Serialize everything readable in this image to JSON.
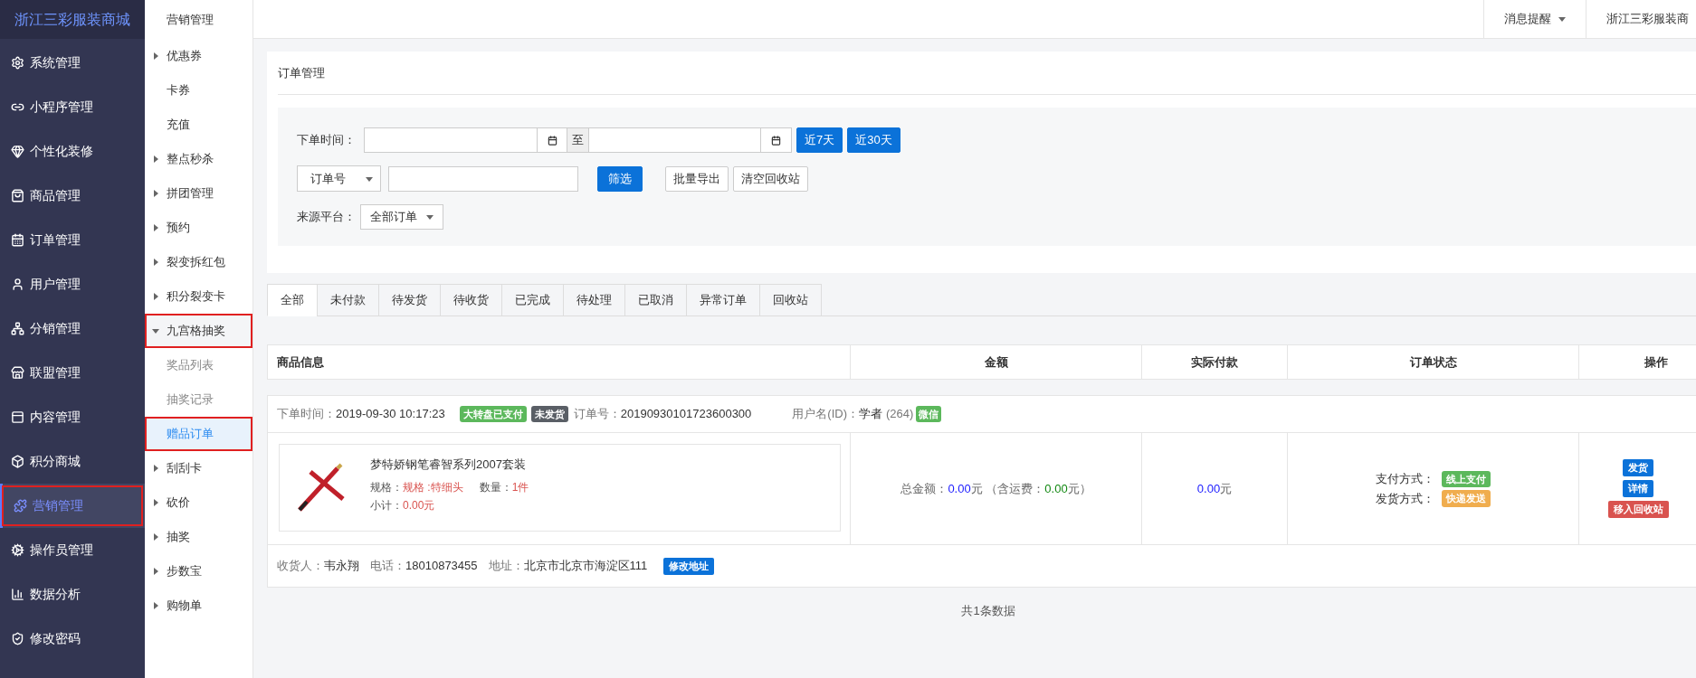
{
  "sidebar": {
    "brand": "浙江三彩服装商城",
    "items": [
      {
        "label": "系统管理",
        "selected": false,
        "annotated": false
      },
      {
        "label": "小程序管理",
        "selected": false,
        "annotated": false
      },
      {
        "label": "个性化装修",
        "selected": false,
        "annotated": false
      },
      {
        "label": "商品管理",
        "selected": false,
        "annotated": false
      },
      {
        "label": "订单管理",
        "selected": false,
        "annotated": false
      },
      {
        "label": "用户管理",
        "selected": false,
        "annotated": false
      },
      {
        "label": "分销管理",
        "selected": false,
        "annotated": false
      },
      {
        "label": "联盟管理",
        "selected": false,
        "annotated": false
      },
      {
        "label": "内容管理",
        "selected": false,
        "annotated": false
      },
      {
        "label": "积分商城",
        "selected": false,
        "annotated": false
      },
      {
        "label": "营销管理",
        "selected": true,
        "annotated": true
      },
      {
        "label": "操作员管理",
        "selected": false,
        "annotated": false
      },
      {
        "label": "数据分析",
        "selected": false,
        "annotated": false
      },
      {
        "label": "修改密码",
        "selected": false,
        "annotated": false
      }
    ]
  },
  "submenu": {
    "title": "营销管理",
    "items": [
      {
        "label": "优惠券",
        "kind": "group",
        "expanded": false,
        "annotated": false
      },
      {
        "label": "卡券",
        "kind": "link",
        "selected": false,
        "annotated": false
      },
      {
        "label": "充值",
        "kind": "link",
        "selected": false,
        "annotated": false
      },
      {
        "label": "整点秒杀",
        "kind": "group",
        "expanded": false,
        "annotated": false
      },
      {
        "label": "拼团管理",
        "kind": "group",
        "expanded": false,
        "annotated": false
      },
      {
        "label": "预约",
        "kind": "group",
        "expanded": false,
        "annotated": false
      },
      {
        "label": "裂变拆红包",
        "kind": "group",
        "expanded": false,
        "annotated": false
      },
      {
        "label": "积分裂变卡",
        "kind": "group",
        "expanded": false,
        "annotated": false
      },
      {
        "label": "九宫格抽奖",
        "kind": "group",
        "expanded": true,
        "annotated": true,
        "children": [
          {
            "label": "奖品列表",
            "kind": "link",
            "selected": false,
            "annotated": false
          },
          {
            "label": "抽奖记录",
            "kind": "link",
            "selected": false,
            "annotated": false
          },
          {
            "label": "赠品订单",
            "kind": "link",
            "selected": true,
            "annotated": true
          }
        ]
      },
      {
        "label": "刮刮卡",
        "kind": "group",
        "expanded": false,
        "annotated": false
      },
      {
        "label": "砍价",
        "kind": "group",
        "expanded": false,
        "annotated": false
      },
      {
        "label": "抽奖",
        "kind": "group",
        "expanded": false,
        "annotated": false
      },
      {
        "label": "步数宝",
        "kind": "group",
        "expanded": false,
        "annotated": false
      },
      {
        "label": "购物单",
        "kind": "group",
        "expanded": false,
        "annotated": false
      }
    ]
  },
  "header": {
    "items": [
      {
        "label": "消息提醒",
        "kind": "dropdown"
      },
      {
        "label": "浙江三彩服装商",
        "kind": "text"
      }
    ]
  },
  "panel": {
    "title": "订单管理",
    "filters": {
      "date_label": "下单时间：",
      "date_separator": "至",
      "quick_buttons": [
        "近7天",
        "近30天"
      ],
      "field_select": "订单号",
      "search_button": "筛选",
      "action_buttons": [
        "批量导出",
        "清空回收站"
      ],
      "source_label": "来源平台：",
      "source_dropdown": "全部订单"
    }
  },
  "tabs": [
    {
      "label": "全部",
      "selected": true
    },
    {
      "label": "未付款",
      "selected": false
    },
    {
      "label": "待发货",
      "selected": false
    },
    {
      "label": "待收货",
      "selected": false
    },
    {
      "label": "已完成",
      "selected": false
    },
    {
      "label": "待处理",
      "selected": false
    },
    {
      "label": "已取消",
      "selected": false
    },
    {
      "label": "异常订单",
      "selected": false
    },
    {
      "label": "回收站",
      "selected": false
    }
  ],
  "table": {
    "columns": [
      "商品信息",
      "金额",
      "实际付款",
      "订单状态",
      "操作"
    ],
    "orders": [
      {
        "time_label": "下单时间：",
        "time": "2019-09-30 10:17:23",
        "badges": [
          {
            "text": "大转盘已支付",
            "color": "#5cb85c"
          },
          {
            "text": "未发货",
            "color": "#5a5f66"
          }
        ],
        "order_no_label": "订单号：",
        "order_no": "20190930101723600300",
        "user_label": "用户名(ID)：",
        "user": "学者",
        "user_id": "(264)",
        "user_badge": {
          "text": "微信",
          "color": "#5cb85c"
        },
        "product": {
          "name": "梦特娇钢笔睿智系列2007套装",
          "spec_label": "规格：",
          "spec": "规格 :特细头",
          "qty_label": "数量：",
          "qty": "1件",
          "subtotal_label": "小计：",
          "subtotal": "0.00元"
        },
        "amount": [
          {
            "text": "总金额：",
            "kind": "label"
          },
          {
            "text": "0.00",
            "kind": "value"
          },
          {
            "text": "元",
            "kind": "label"
          },
          {
            "text": "（含运费：",
            "kind": "label"
          },
          {
            "text": "0.00",
            "kind": "freight"
          },
          {
            "text": "元）",
            "kind": "label"
          }
        ],
        "paid": {
          "value": "0.00",
          "unit": "元"
        },
        "status": [
          {
            "label": "支付方式：",
            "badge": "线上支付",
            "color": "#5cb85c"
          },
          {
            "label": "发货方式：",
            "badge": "快递发送",
            "color": "#f0ad4e"
          }
        ],
        "actions": [
          {
            "label": "发货",
            "kind": "primary"
          },
          {
            "label": "详情",
            "kind": "primary"
          },
          {
            "label": "移入回收站",
            "kind": "danger"
          }
        ],
        "shipping": {
          "receiver_label": "收货人：",
          "receiver": "韦永翔",
          "phone_label": "电话：",
          "phone": "18010873455",
          "address_label": "地址：",
          "address": "北京市北京市海淀区111",
          "edit_button": "修改地址"
        }
      }
    ]
  },
  "footer": "共1条数据"
}
